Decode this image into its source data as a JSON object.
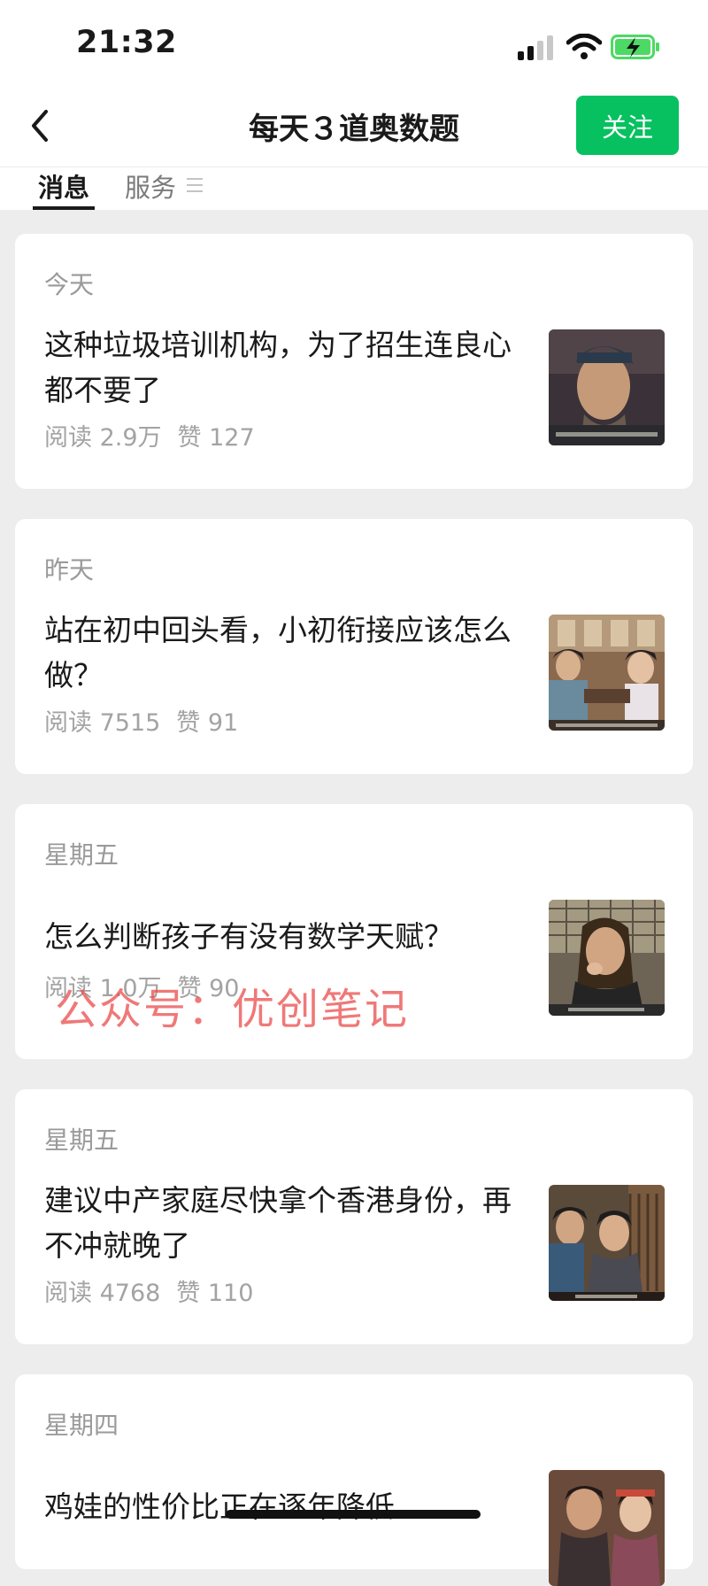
{
  "status_bar": {
    "time": "21:32"
  },
  "nav": {
    "title": "每天３道奥数题",
    "follow_label": "关注"
  },
  "tabs": [
    {
      "label": "消息"
    },
    {
      "label": "服务"
    }
  ],
  "articles": [
    {
      "date": "今天",
      "title": "这种垃圾培训机构，为了招生连良心都不要了",
      "reads": "阅读 2.9万",
      "likes": "赞 127"
    },
    {
      "date": "昨天",
      "title": "站在初中回头看，小初衔接应该怎么做？",
      "reads": "阅读 7515",
      "likes": "赞 91"
    },
    {
      "date": "星期五",
      "title": "怎么判断孩子有没有数学天赋？",
      "reads": "阅读 1.0万",
      "likes": "赞 90"
    },
    {
      "date": "星期五",
      "title": "建议中产家庭尽快拿个香港身份，再不冲就晚了",
      "reads": "阅读 4768",
      "likes": "赞 110"
    },
    {
      "date": "星期四",
      "title": "鸡娃的性价比正在逐年降低"
    }
  ],
  "watermark": "公众号：优创笔记",
  "colors": {
    "accent": "#07c160",
    "background": "#ededed",
    "watermark": "#ec4b4b"
  }
}
